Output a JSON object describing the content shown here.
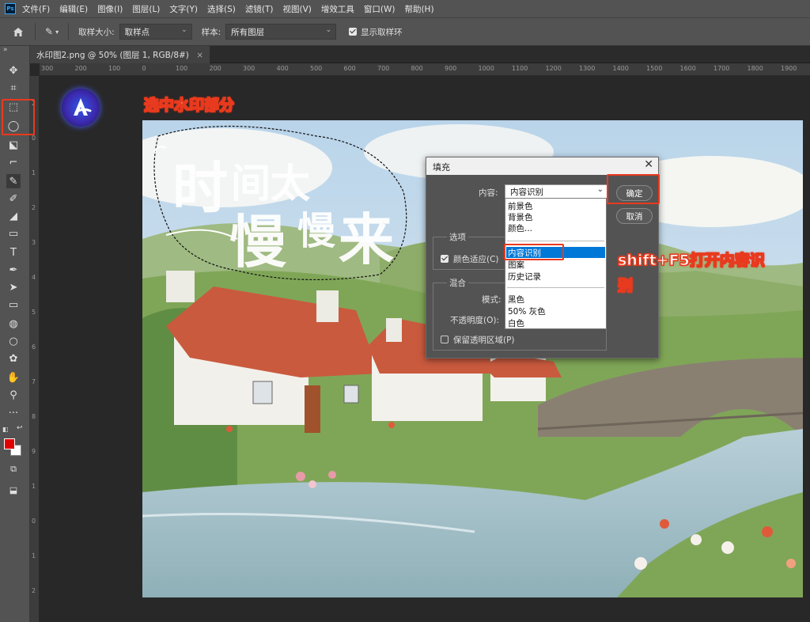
{
  "app": {
    "logo_text": "Ps"
  },
  "menubar": {
    "items": [
      "文件(F)",
      "编辑(E)",
      "图像(I)",
      "图层(L)",
      "文字(Y)",
      "选择(S)",
      "滤镜(T)",
      "视图(V)",
      "增效工具",
      "窗口(W)",
      "帮助(H)"
    ]
  },
  "options": {
    "sample_size_label": "取样大小:",
    "sample_size_value": "取样点",
    "sample_label": "样本:",
    "sample_value": "所有图层",
    "show_ring_label": "显示取样环"
  },
  "document": {
    "tab_title": "水印图2.png @ 50% (图层 1, RGB/8#)",
    "close_glyph": "×"
  },
  "rulers": {
    "top": [
      "300",
      "200",
      "100",
      "0",
      "100",
      "200",
      "300",
      "400",
      "500",
      "600",
      "700",
      "800",
      "900",
      "1000",
      "1100",
      "1200",
      "1300",
      "1400",
      "1500",
      "1600",
      "1700",
      "1800",
      "1900"
    ],
    "left": [
      "2",
      "0",
      "1",
      "2",
      "3",
      "4",
      "5",
      "6",
      "7",
      "8",
      "9",
      "1",
      "0",
      "1",
      "2"
    ]
  },
  "tools": [
    {
      "name": "move-icon",
      "glyph": "✥"
    },
    {
      "name": "artboard-icon",
      "glyph": "⌗"
    },
    {
      "name": "marquee-icon",
      "glyph": "⬚"
    },
    {
      "name": "lasso-icon",
      "glyph": "◯"
    },
    {
      "name": "object-select-icon",
      "glyph": "⬕"
    },
    {
      "name": "crop-icon",
      "glyph": "⌐"
    },
    {
      "name": "eyedropper-icon",
      "glyph": "✎"
    },
    {
      "name": "brush-icon",
      "glyph": "✐"
    },
    {
      "name": "eraser-icon",
      "glyph": "◢"
    },
    {
      "name": "gradient-icon",
      "glyph": "▭"
    },
    {
      "name": "type-icon",
      "glyph": "T"
    },
    {
      "name": "pen-icon",
      "glyph": "✒"
    },
    {
      "name": "path-select-icon",
      "glyph": "➤"
    },
    {
      "name": "rectangle-icon",
      "glyph": "▭"
    },
    {
      "name": "paint-bucket-icon",
      "glyph": "◍"
    },
    {
      "name": "ellipse-icon",
      "glyph": "○"
    },
    {
      "name": "custom-shape-icon",
      "glyph": "✿"
    },
    {
      "name": "hand-icon",
      "glyph": "✋"
    },
    {
      "name": "zoom-icon",
      "glyph": "⚲"
    },
    {
      "name": "more-tools-icon",
      "glyph": "···"
    }
  ],
  "colors": {
    "foreground": "#e00000",
    "background": "#ffffff",
    "accent_red": "#e83a1e",
    "highlight": "#0078d7"
  },
  "annotations": {
    "select_watermark": "选中水印部分",
    "shortcut_line1": "shift+F5打开内容识",
    "shortcut_line2": "别"
  },
  "watermark": {
    "line1_big": "时",
    "line1_rest": "间太",
    "line2a": "慢",
    "line2b": "慢",
    "line2c": "来"
  },
  "dialog": {
    "title": "填充",
    "close_glyph": "✕",
    "content_label": "内容:",
    "content_value": "内容识别",
    "ok_label": "确定",
    "cancel_label": "取消",
    "options_group": "选项",
    "color_adapt_label": "颜色适应(C)",
    "blend_group": "混合",
    "mode_label": "模式:",
    "opacity_label": "不透明度(O):",
    "preserve_label": "保留透明区域(P)",
    "dropdown_options": [
      "前景色",
      "背景色",
      "颜色...",
      "内容识别",
      "图案",
      "历史记录",
      "黑色",
      "50% 灰色",
      "白色"
    ]
  }
}
